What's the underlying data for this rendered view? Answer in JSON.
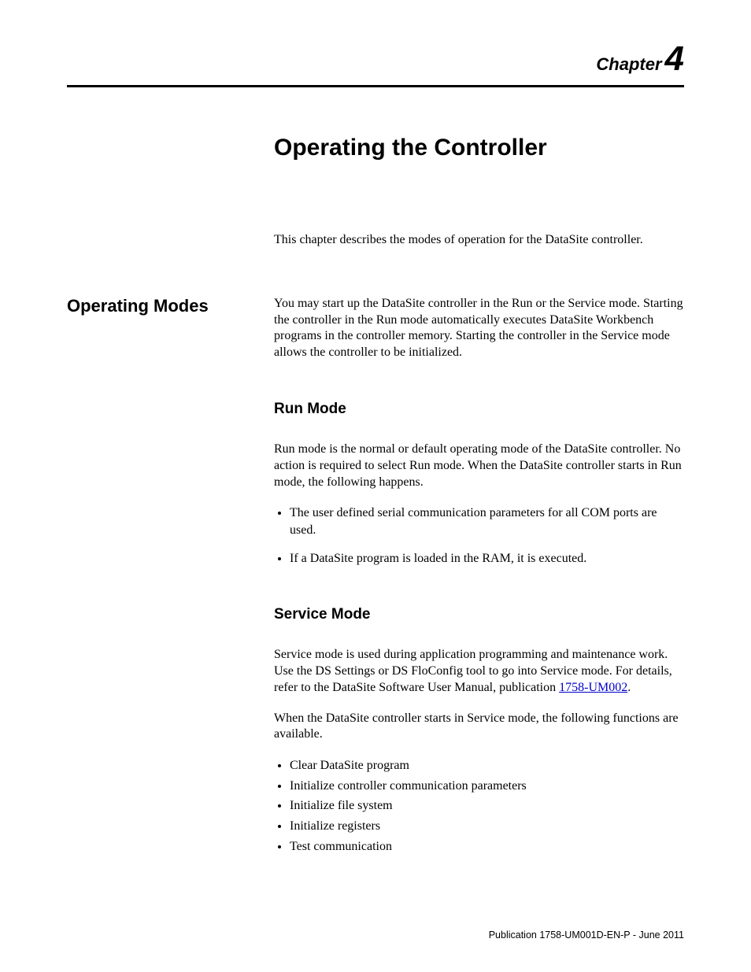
{
  "chapter": {
    "label": "Chapter",
    "number": "4"
  },
  "title": "Operating the Controller",
  "intro": "This chapter describes the modes of operation for the DataSite controller.",
  "operating_modes": {
    "heading": "Operating Modes",
    "body": "You may start up the DataSite controller in the Run or the Service mode. Starting the controller in the Run mode automatically executes DataSite Workbench programs in the controller memory. Starting the controller in the Service mode allows the controller to be initialized."
  },
  "run_mode": {
    "heading": "Run Mode",
    "body": "Run mode is the normal or default operating mode of the DataSite controller. No action is required to select Run mode. When the DataSite controller starts in Run mode, the following happens.",
    "bullets": [
      "The user defined serial communication parameters for all COM ports are used.",
      "If a DataSite program is loaded in the RAM, it is executed."
    ]
  },
  "service_mode": {
    "heading": "Service Mode",
    "body_pre": "Service mode is used during application programming and maintenance work. Use the DS Settings or DS FloConfig tool to go into Service mode. For details, refer to the DataSite Software User Manual, publication ",
    "link_text": "1758-UM002",
    "body_post": ".",
    "body2": "When the DataSite controller starts in Service mode, the following functions are available.",
    "bullets": [
      "Clear DataSite program",
      "Initialize controller communication parameters",
      "Initialize file system",
      "Initialize registers",
      "Test communication"
    ]
  },
  "footer": "Publication 1758-UM001D-EN-P - June 2011"
}
